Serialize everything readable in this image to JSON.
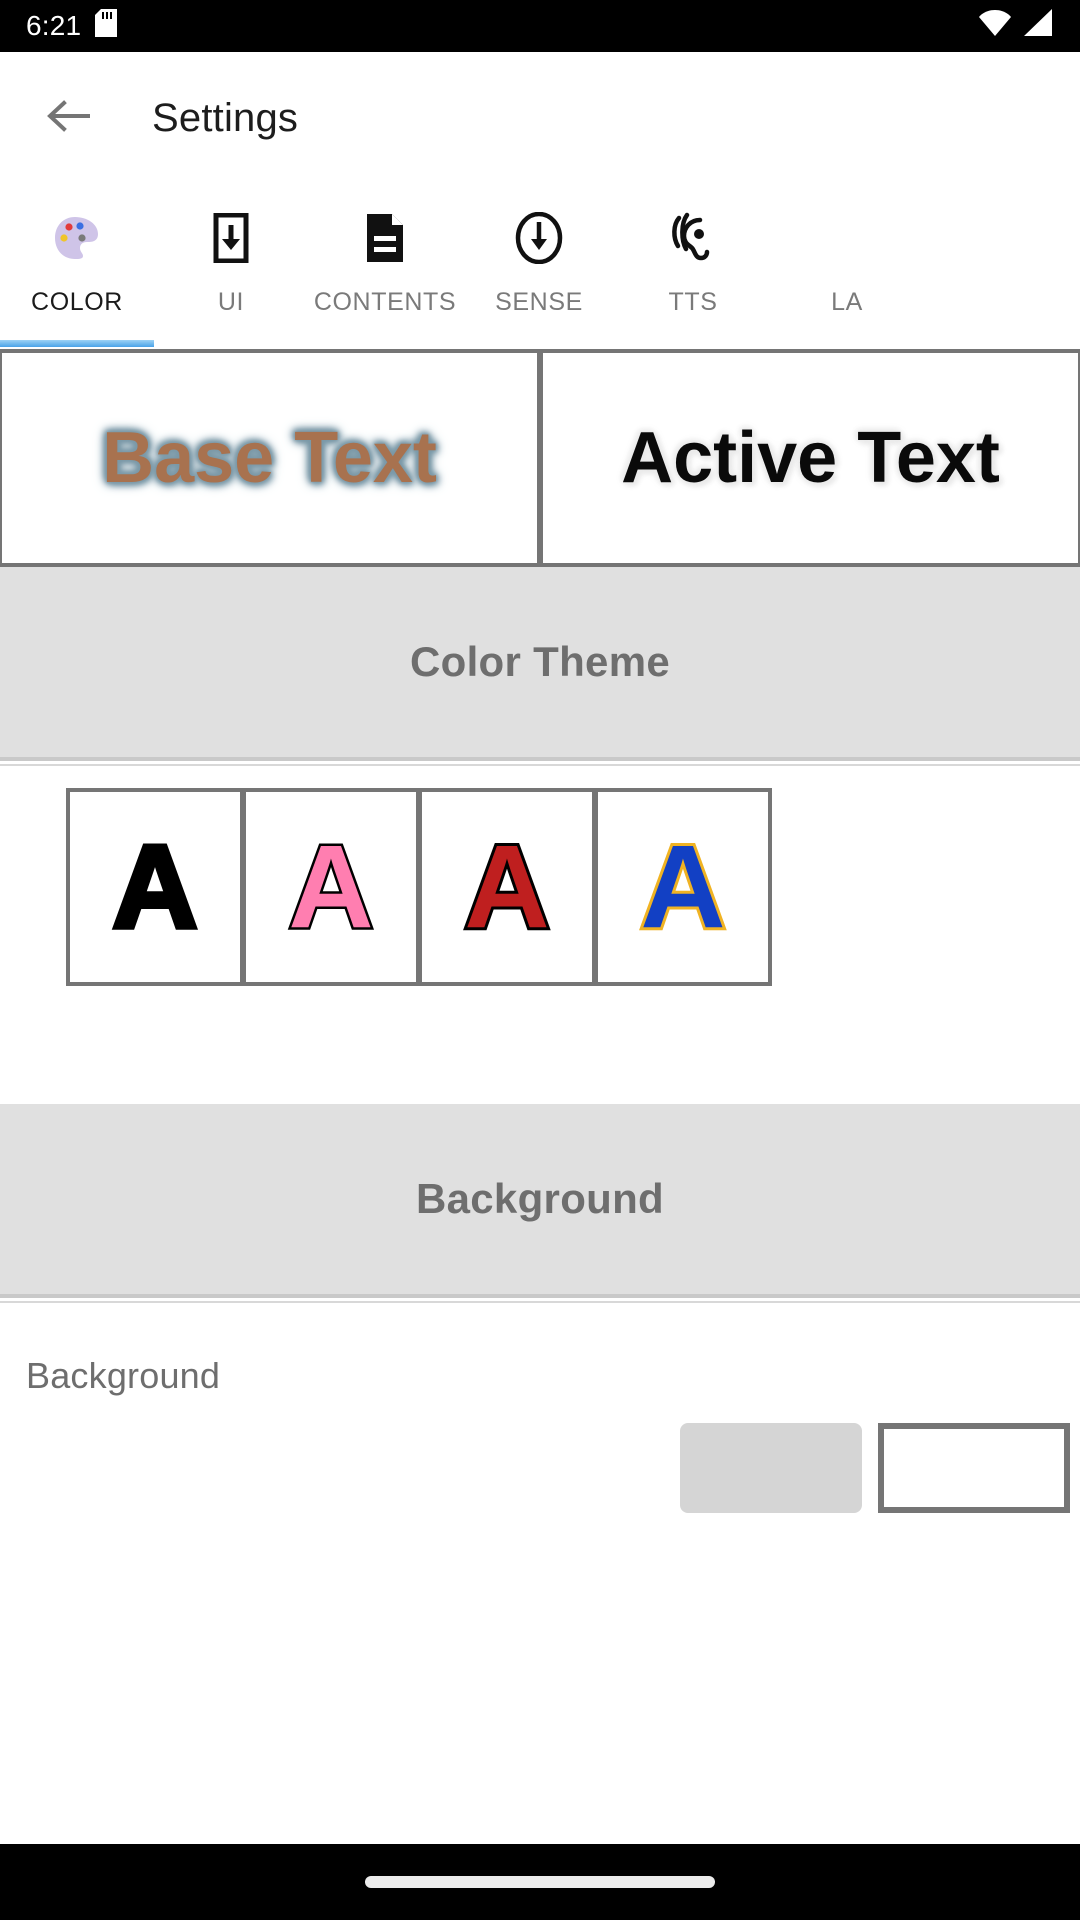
{
  "status_bar": {
    "time": "6:21",
    "icons": [
      "sd-card-icon",
      "wifi-icon",
      "signal-icon"
    ]
  },
  "app_bar": {
    "back_icon": "arrow-back-icon",
    "title": "Settings"
  },
  "tabs": {
    "active_index": 0,
    "items": [
      {
        "label": "COLOR",
        "icon": "palette-icon"
      },
      {
        "label": "UI",
        "icon": "phone-download-icon"
      },
      {
        "label": "CONTENTS",
        "icon": "document-icon"
      },
      {
        "label": "SENSE",
        "icon": "circle-arrow-down-icon"
      },
      {
        "label": "TTS",
        "icon": "ear-sound-icon"
      },
      {
        "label": "LA",
        "icon": "language-icon"
      }
    ]
  },
  "preview": {
    "base": {
      "label": "Base Text",
      "color": "#a8724f",
      "shadow_color": "#7b99a8"
    },
    "active": {
      "label": "Active Text",
      "color": "#0a0a0a",
      "shadow_color": "#ececec"
    }
  },
  "color_theme": {
    "title": "Color Theme",
    "swatches": [
      {
        "letter": "A",
        "fill": "#000000",
        "outline": "#000000"
      },
      {
        "letter": "A",
        "fill": "#ff7eb0",
        "outline": "#000000"
      },
      {
        "letter": "A",
        "fill": "#bf1f1f",
        "outline": "#000000"
      },
      {
        "letter": "A",
        "fill": "#1240c4",
        "outline": "#f0b323"
      }
    ]
  },
  "background_section": {
    "title": "Background",
    "row_label": "Background",
    "button_color": "#d5d5d5",
    "swatch_color": "#ffffff",
    "swatch_border": "#757575"
  },
  "nav_bar": {
    "handle": "home-gesture-pill"
  }
}
